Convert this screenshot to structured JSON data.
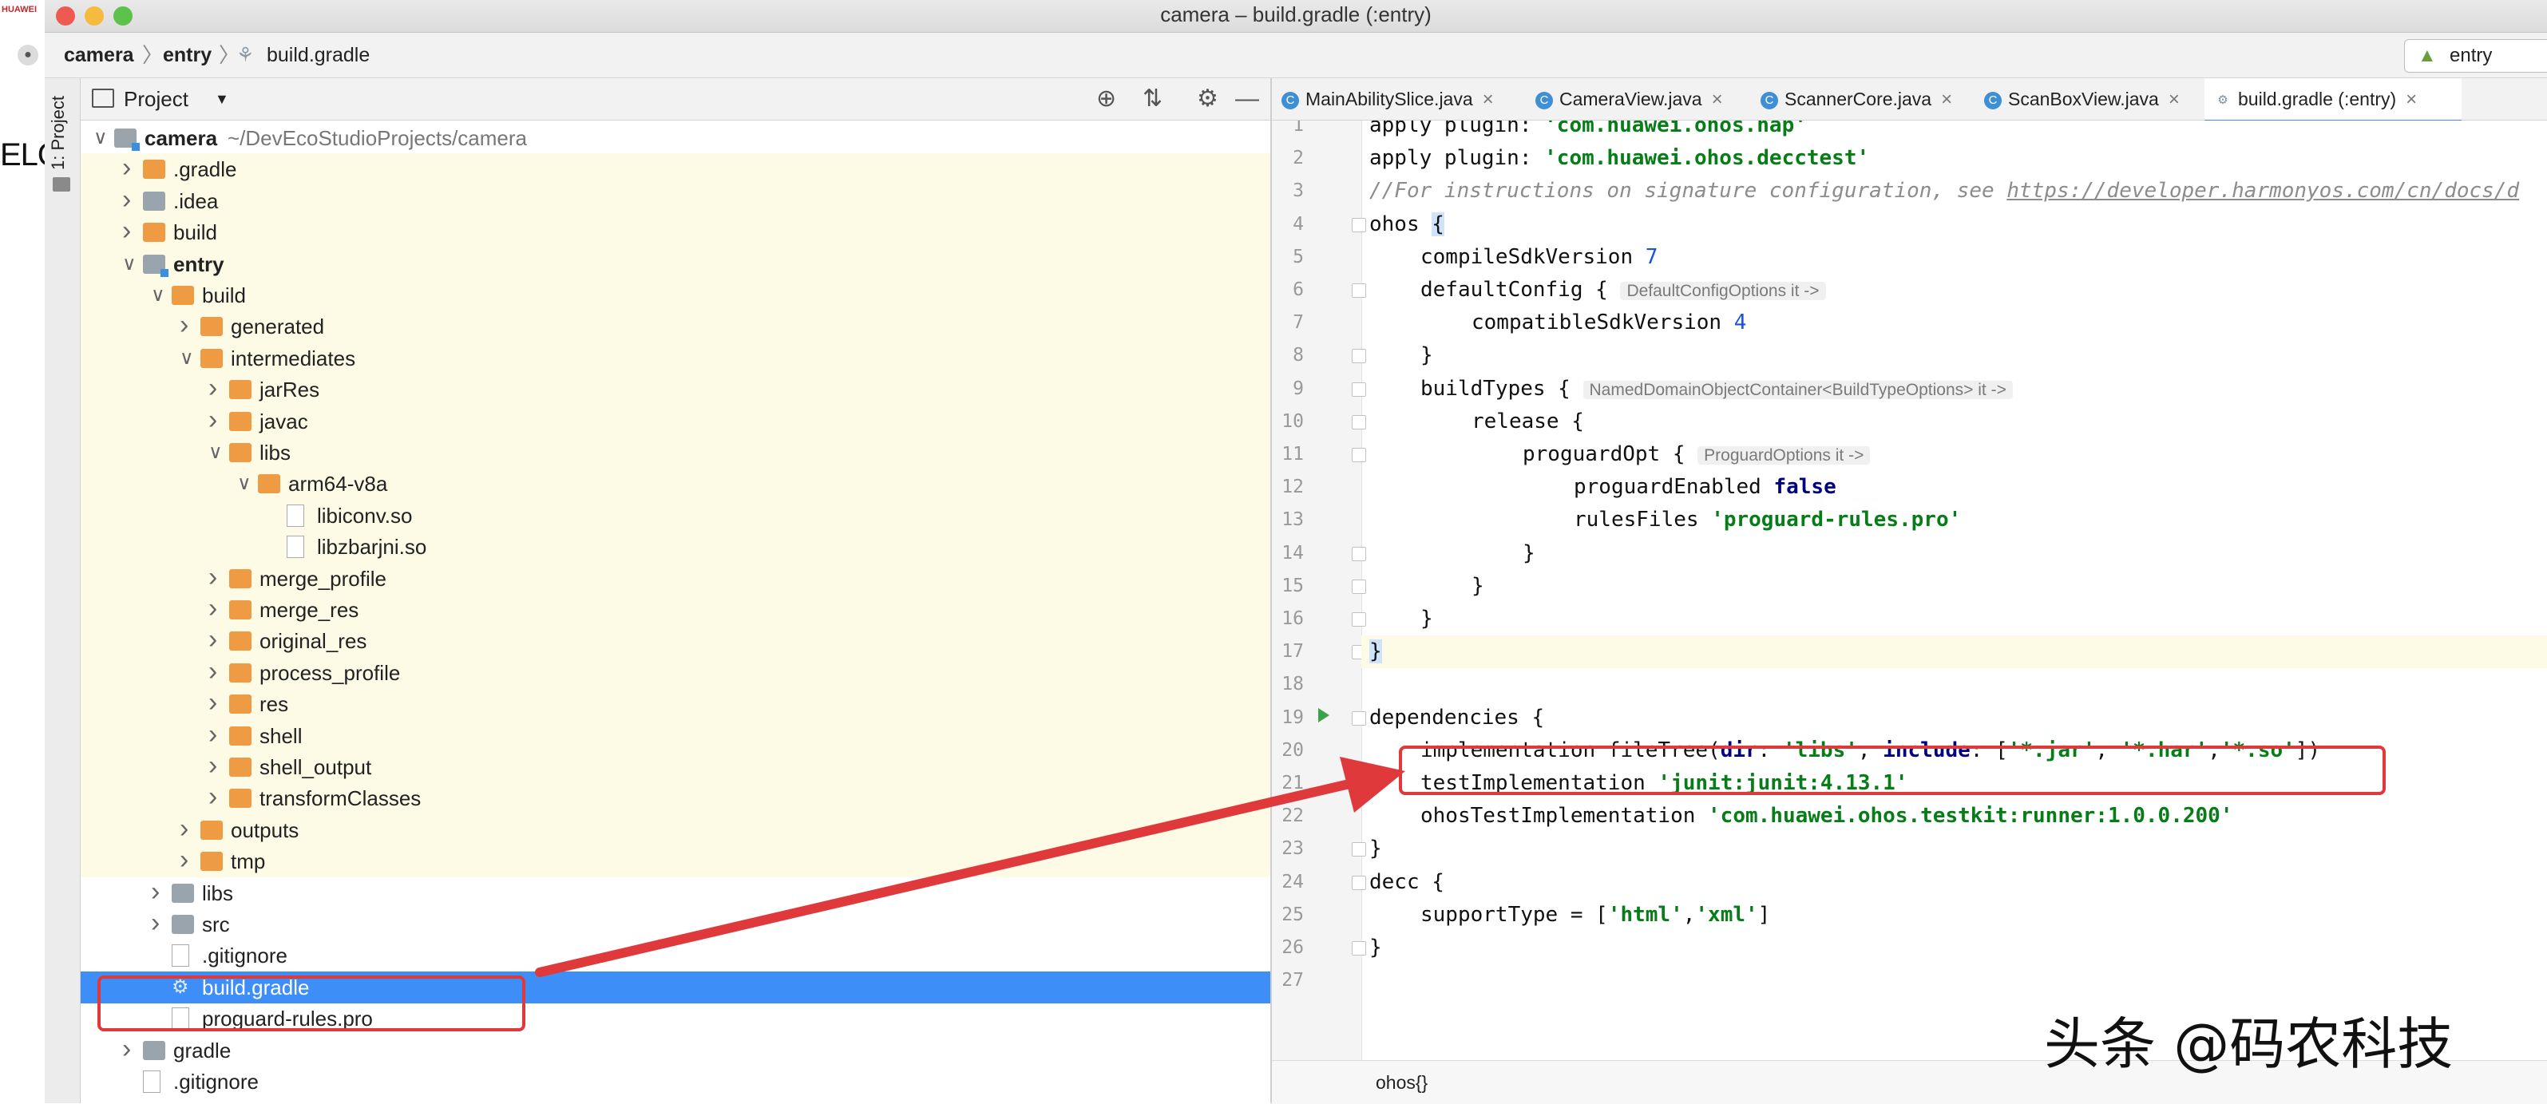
{
  "background_app": {
    "brand": "HUAWEI",
    "partial_text": "ELO"
  },
  "window": {
    "title": "camera – build.gradle (:entry)"
  },
  "breadcrumb": {
    "items": [
      "camera",
      "entry",
      "build.gradle"
    ]
  },
  "run_config": {
    "label": "entry"
  },
  "tool_strip": {
    "project_label": "1: Project"
  },
  "project_panel": {
    "title": "Project",
    "tree": [
      {
        "label": "camera",
        "sub": "~/DevEcoStudioProjects/camera",
        "depth": 0,
        "state": "open",
        "kind": "module",
        "bold": true
      },
      {
        "label": ".gradle",
        "depth": 1,
        "state": "closed",
        "kind": "folder",
        "hl": true
      },
      {
        "label": ".idea",
        "depth": 1,
        "state": "closed",
        "kind": "folder-grey",
        "hl": true
      },
      {
        "label": "build",
        "depth": 1,
        "state": "closed",
        "kind": "folder",
        "hl": true
      },
      {
        "label": "entry",
        "depth": 1,
        "state": "open",
        "kind": "module",
        "bold": true,
        "hl": true
      },
      {
        "label": "build",
        "depth": 2,
        "state": "open",
        "kind": "folder",
        "hl": true
      },
      {
        "label": "generated",
        "depth": 3,
        "state": "closed",
        "kind": "folder",
        "hl": true
      },
      {
        "label": "intermediates",
        "depth": 3,
        "state": "open",
        "kind": "folder",
        "hl": true
      },
      {
        "label": "jarRes",
        "depth": 4,
        "state": "closed",
        "kind": "folder",
        "hl": true
      },
      {
        "label": "javac",
        "depth": 4,
        "state": "closed",
        "kind": "folder",
        "hl": true
      },
      {
        "label": "libs",
        "depth": 4,
        "state": "open",
        "kind": "folder",
        "hl": true
      },
      {
        "label": "arm64-v8a",
        "depth": 5,
        "state": "open",
        "kind": "folder",
        "hl": true
      },
      {
        "label": "libiconv.so",
        "depth": 6,
        "state": "none",
        "kind": "file",
        "hl": true
      },
      {
        "label": "libzbarjni.so",
        "depth": 6,
        "state": "none",
        "kind": "file",
        "hl": true
      },
      {
        "label": "merge_profile",
        "depth": 4,
        "state": "closed",
        "kind": "folder",
        "hl": true
      },
      {
        "label": "merge_res",
        "depth": 4,
        "state": "closed",
        "kind": "folder",
        "hl": true
      },
      {
        "label": "original_res",
        "depth": 4,
        "state": "closed",
        "kind": "folder",
        "hl": true
      },
      {
        "label": "process_profile",
        "depth": 4,
        "state": "closed",
        "kind": "folder",
        "hl": true
      },
      {
        "label": "res",
        "depth": 4,
        "state": "closed",
        "kind": "folder",
        "hl": true
      },
      {
        "label": "shell",
        "depth": 4,
        "state": "closed",
        "kind": "folder",
        "hl": true
      },
      {
        "label": "shell_output",
        "depth": 4,
        "state": "closed",
        "kind": "folder",
        "hl": true
      },
      {
        "label": "transformClasses",
        "depth": 4,
        "state": "closed",
        "kind": "folder",
        "hl": true
      },
      {
        "label": "outputs",
        "depth": 3,
        "state": "closed",
        "kind": "folder",
        "hl": true
      },
      {
        "label": "tmp",
        "depth": 3,
        "state": "closed",
        "kind": "folder",
        "hl": true
      },
      {
        "label": "libs",
        "depth": 2,
        "state": "closed",
        "kind": "folder-grey"
      },
      {
        "label": "src",
        "depth": 2,
        "state": "closed",
        "kind": "folder-grey"
      },
      {
        "label": ".gitignore",
        "depth": 2,
        "state": "none",
        "kind": "file"
      },
      {
        "label": "build.gradle",
        "depth": 2,
        "state": "none",
        "kind": "gradle",
        "selected": true
      },
      {
        "label": "proguard-rules.pro",
        "depth": 2,
        "state": "none",
        "kind": "file"
      },
      {
        "label": "gradle",
        "depth": 1,
        "state": "closed",
        "kind": "folder-grey"
      },
      {
        "label": ".gitignore",
        "depth": 1,
        "state": "none",
        "kind": "file"
      }
    ]
  },
  "editor": {
    "tabs": [
      {
        "label": "MainAbilitySlice.java",
        "kind": "class"
      },
      {
        "label": "CameraView.java",
        "kind": "class"
      },
      {
        "label": "ScannerCore.java",
        "kind": "class"
      },
      {
        "label": "ScanBoxView.java",
        "kind": "class"
      },
      {
        "label": "build.gradle (:entry)",
        "kind": "gradle",
        "active": true
      }
    ],
    "lines": [
      {
        "n": "1",
        "indent": 0,
        "segs": [
          [
            "t",
            "apply plugin: "
          ],
          [
            "str",
            "'com.huawei.ohos.hap'"
          ]
        ]
      },
      {
        "n": "2",
        "indent": 0,
        "segs": [
          [
            "t",
            "apply plugin: "
          ],
          [
            "str",
            "'com.huawei.ohos.decctest'"
          ]
        ]
      },
      {
        "n": "3",
        "indent": 0,
        "segs": [
          [
            "cmt",
            "//For instructions on signature configuration, see "
          ],
          [
            "url",
            "https://developer.harmonyos.com/cn/docs/d"
          ]
        ]
      },
      {
        "n": "4",
        "indent": 0,
        "fold": true,
        "segs": [
          [
            "t",
            "ohos "
          ],
          [
            "brace",
            "{"
          ]
        ]
      },
      {
        "n": "5",
        "indent": 1,
        "segs": [
          [
            "t",
            "compileSdkVersion "
          ],
          [
            "num",
            "7"
          ]
        ]
      },
      {
        "n": "6",
        "indent": 1,
        "fold": true,
        "segs": [
          [
            "t",
            "defaultConfig { "
          ],
          [
            "hint",
            "DefaultConfigOptions it ->"
          ]
        ]
      },
      {
        "n": "7",
        "indent": 2,
        "segs": [
          [
            "t",
            "compatibleSdkVersion "
          ],
          [
            "num",
            "4"
          ]
        ]
      },
      {
        "n": "8",
        "indent": 1,
        "fold": true,
        "segs": [
          [
            "t",
            "}"
          ]
        ]
      },
      {
        "n": "9",
        "indent": 1,
        "fold": true,
        "segs": [
          [
            "t",
            "buildTypes { "
          ],
          [
            "hint",
            "NamedDomainObjectContainer<BuildTypeOptions> it ->"
          ]
        ]
      },
      {
        "n": "10",
        "indent": 2,
        "fold": true,
        "segs": [
          [
            "t",
            "release {"
          ]
        ]
      },
      {
        "n": "11",
        "indent": 3,
        "fold": true,
        "segs": [
          [
            "t",
            "proguardOpt { "
          ],
          [
            "hint",
            "ProguardOptions it ->"
          ]
        ]
      },
      {
        "n": "12",
        "indent": 4,
        "segs": [
          [
            "t",
            "proguardEnabled "
          ],
          [
            "kw",
            "false"
          ]
        ]
      },
      {
        "n": "13",
        "indent": 4,
        "segs": [
          [
            "t",
            "rulesFiles "
          ],
          [
            "str",
            "'proguard-rules.pro'"
          ]
        ]
      },
      {
        "n": "14",
        "indent": 3,
        "fold": true,
        "segs": [
          [
            "t",
            "}"
          ]
        ]
      },
      {
        "n": "15",
        "indent": 2,
        "fold": true,
        "segs": [
          [
            "t",
            "}"
          ]
        ]
      },
      {
        "n": "16",
        "indent": 1,
        "fold": true,
        "segs": [
          [
            "t",
            "}"
          ]
        ]
      },
      {
        "n": "17",
        "indent": 0,
        "fold": true,
        "current": true,
        "segs": [
          [
            "brace",
            "}"
          ]
        ]
      },
      {
        "n": "18",
        "indent": 0,
        "segs": []
      },
      {
        "n": "19",
        "indent": 0,
        "fold": true,
        "run": true,
        "segs": [
          [
            "t",
            "dependencies {"
          ]
        ]
      },
      {
        "n": "20",
        "indent": 1,
        "segs": [
          [
            "t",
            "implementation fileTree("
          ],
          [
            "kw",
            "dir"
          ],
          [
            "t",
            ": "
          ],
          [
            "str",
            "'libs'"
          ],
          [
            "t",
            ", "
          ],
          [
            "kw",
            "include"
          ],
          [
            "t",
            ": ["
          ],
          [
            "str",
            "'*.jar'"
          ],
          [
            "t",
            ", "
          ],
          [
            "str",
            "'*.har'"
          ],
          [
            "t",
            ","
          ],
          [
            "str",
            "'*.so'"
          ],
          [
            "t",
            "])"
          ]
        ]
      },
      {
        "n": "21",
        "indent": 1,
        "segs": [
          [
            "t",
            "testImplementation "
          ],
          [
            "str",
            "'junit:junit:4.13.1'"
          ]
        ]
      },
      {
        "n": "22",
        "indent": 1,
        "segs": [
          [
            "t",
            "ohosTestImplementation "
          ],
          [
            "str",
            "'com.huawei.ohos.testkit:runner:1.0.0.200'"
          ]
        ]
      },
      {
        "n": "23",
        "indent": 0,
        "fold": true,
        "segs": [
          [
            "t",
            "}"
          ]
        ]
      },
      {
        "n": "24",
        "indent": 0,
        "fold": true,
        "segs": [
          [
            "t",
            "decc {"
          ]
        ]
      },
      {
        "n": "25",
        "indent": 1,
        "segs": [
          [
            "t",
            "supportType = ["
          ],
          [
            "str",
            "'html'"
          ],
          [
            "t",
            ","
          ],
          [
            "str",
            "'xml'"
          ],
          [
            "t",
            "]"
          ]
        ]
      },
      {
        "n": "26",
        "indent": 0,
        "fold": true,
        "segs": [
          [
            "t",
            "}"
          ]
        ]
      },
      {
        "n": "27",
        "indent": 0,
        "segs": []
      }
    ],
    "status_crumb": "ohos{}"
  },
  "watermark": "头条 @码农科技",
  "colors": {
    "annotation_red": "#e0393c",
    "selection_blue": "#3d8ef7",
    "folder_orange": "#ef9b43"
  },
  "icons": [
    "close-window-icon",
    "minimize-window-icon",
    "zoom-window-icon",
    "chevron-right-icon",
    "chevron-down-icon",
    "folder-icon",
    "module-icon",
    "file-icon",
    "gradle-icon",
    "locate-icon",
    "collapse-all-icon",
    "gear-icon",
    "hide-icon",
    "class-icon",
    "close-tab-icon",
    "fold-icon",
    "run-gutter-icon",
    "dropdown-icon"
  ]
}
